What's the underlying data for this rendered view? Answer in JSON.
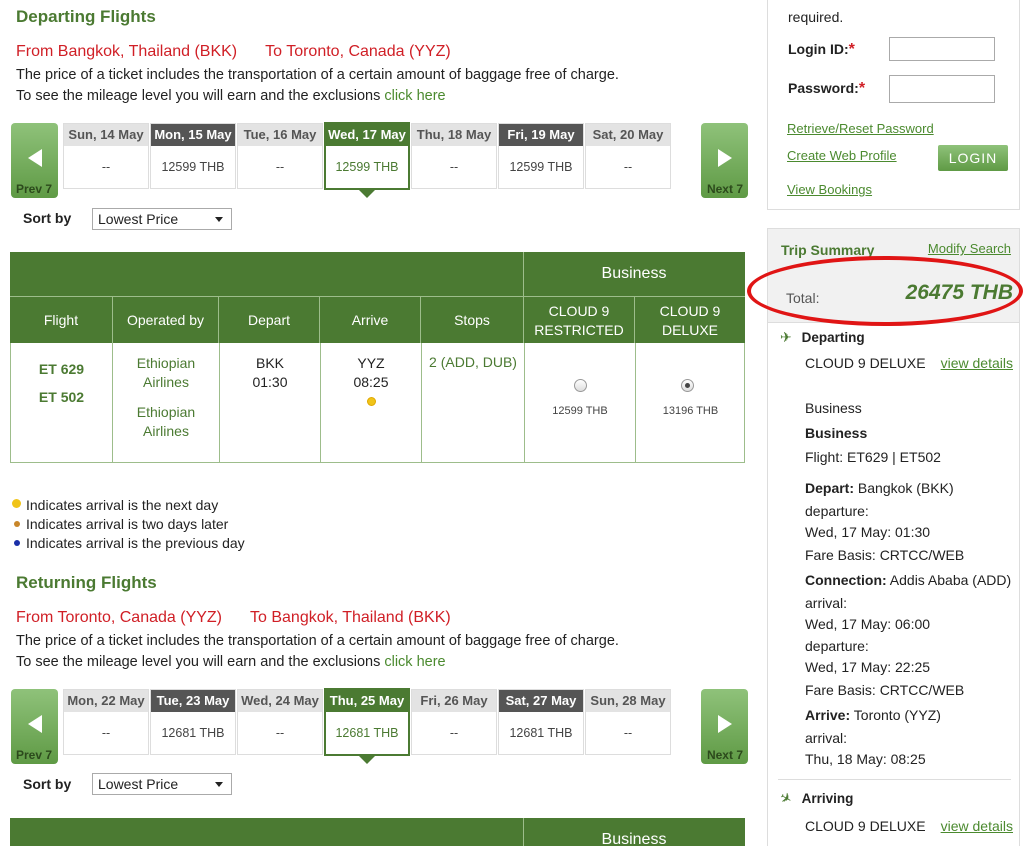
{
  "departing": {
    "title": "Departing Flights",
    "from": "From Bangkok, Thailand (BKK)",
    "to": "To Toronto, Canada (YYZ)",
    "info_line1": "The price of a ticket includes the transportation of a certain amount of baggage free of charge.",
    "info_line2": "To see the mileage level you will earn and the exclusions",
    "info_link": "click here",
    "prev_label": "Prev 7",
    "next_label": "Next 7",
    "days": [
      {
        "label": "Sun, 14 May",
        "price": "--"
      },
      {
        "label": "Mon, 15 May",
        "price": "12599 THB"
      },
      {
        "label": "Tue, 16 May",
        "price": "--"
      },
      {
        "label": "Wed, 17 May",
        "price": "12599 THB"
      },
      {
        "label": "Thu, 18 May",
        "price": "--"
      },
      {
        "label": "Fri, 19 May",
        "price": "12599 THB"
      },
      {
        "label": "Sat, 20 May",
        "price": "--"
      }
    ],
    "sort_label": "Sort by",
    "sort_value": "Lowest Price"
  },
  "table": {
    "cabin_header": "Business",
    "columns": [
      "Flight",
      "Operated by",
      "Depart",
      "Arrive",
      "Stops",
      "CLOUD 9 RESTRICTED",
      "CLOUD 9 DELUXE"
    ],
    "col_restricted_1": "CLOUD 9",
    "col_restricted_2": "RESTRICTED",
    "col_deluxe_1": "CLOUD 9",
    "col_deluxe_2": "DELUXE",
    "row": {
      "flight1": "ET 629",
      "flight2": "ET 502",
      "operator1_a": "Ethiopian",
      "operator1_b": "Airlines",
      "operator2_a": "Ethiopian",
      "operator2_b": "Airlines",
      "depart_code": "BKK",
      "depart_time": "01:30",
      "arrive_code": "YYZ",
      "arrive_time": "08:25",
      "stops": "2 (ADD, DUB)",
      "price_restricted": "12599 THB",
      "price_deluxe": "13196 THB",
      "selected": "deluxe"
    }
  },
  "legend": {
    "next_day": "Indicates arrival is the next day",
    "two_days": "Indicates arrival is two days later",
    "prev_day": "Indicates arrival is the previous day",
    "colors": {
      "next_day": "#f0c419",
      "two_days": "#c8862a",
      "prev_day": "#1a2fa8"
    }
  },
  "returning": {
    "title": "Returning Flights",
    "from": "From Toronto, Canada (YYZ)",
    "to": "To Bangkok, Thailand (BKK)",
    "info_line1": "The price of a ticket includes the transportation of a certain amount of baggage free of charge.",
    "info_line2": "To see the mileage level you will earn and the exclusions",
    "info_link": "click here",
    "prev_label": "Prev 7",
    "next_label": "Next 7",
    "days": [
      {
        "label": "Mon, 22 May",
        "price": "--"
      },
      {
        "label": "Tue, 23 May",
        "price": "12681 THB"
      },
      {
        "label": "Wed, 24 May",
        "price": "--"
      },
      {
        "label": "Thu, 25 May",
        "price": "12681 THB"
      },
      {
        "label": "Fri, 26 May",
        "price": "--"
      },
      {
        "label": "Sat, 27 May",
        "price": "12681 THB"
      },
      {
        "label": "Sun, 28 May",
        "price": "--"
      }
    ],
    "sort_label": "Sort by",
    "sort_value": "Lowest Price",
    "cabin_header": "Business"
  },
  "login": {
    "required_note": "required.",
    "login_id_label": "Login ID:",
    "password_label": "Password:",
    "star": "*",
    "reset_link": "Retrieve/Reset Password",
    "create_link": "Create Web Profile",
    "login_button": "LOGIN",
    "bookings_link": "View Bookings"
  },
  "trip": {
    "title": "Trip Summary",
    "modify": "Modify Search",
    "total_label": "Total:",
    "total_value": "26475 THB",
    "departing_title": "Departing",
    "dep_fare": "CLOUD 9 DELUXE",
    "view_details": "view details",
    "cabin1": "Business",
    "cabin2": "Business",
    "flight": "Flight: ET629 | ET502",
    "depart_label": "Depart:",
    "depart_value": "Bangkok (BKK)",
    "departure_label": "departure:",
    "departure_value": "Wed, 17 May: 01:30",
    "fare_basis1": "Fare Basis: CRTCC/WEB",
    "connection_label": "Connection:",
    "connection_value": "Addis Ababa (ADD)",
    "arrival_label": "arrival:",
    "conn_arrival_value": "Wed, 17 May: 06:00",
    "departure2_label": "departure:",
    "conn_departure_value": "Wed, 17 May: 22:25",
    "fare_basis2": "Fare Basis: CRTCC/WEB",
    "arrive_label": "Arrive:",
    "arrive_value": "Toronto (YYZ)",
    "arrival2_label": "arrival:",
    "final_arrival_value": "Thu, 18 May: 08:25",
    "arriving_title": "Arriving",
    "arr_fare": "CLOUD 9 DELUXE",
    "view_details2": "view details"
  },
  "colors": {
    "brand_green": "#4b7a32",
    "route_red": "#d01f26",
    "highlight_oval": "#e01515"
  }
}
